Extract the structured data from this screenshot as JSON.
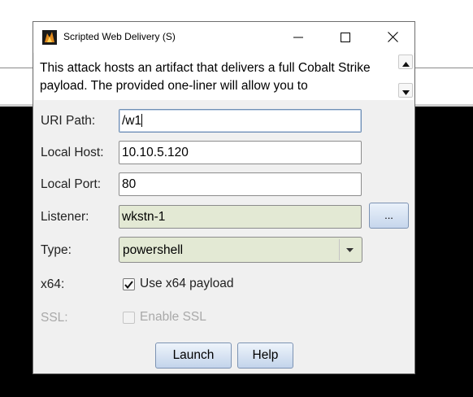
{
  "window": {
    "title": "Scripted Web Delivery (S)"
  },
  "description": "This attack hosts an artifact that delivers a full Cobalt Strike payload. The provided one-liner will allow you to",
  "form": {
    "uri_path": {
      "label": "URI Path:",
      "value": "/w1"
    },
    "local_host": {
      "label": "Local Host:",
      "value": "10.10.5.120"
    },
    "local_port": {
      "label": "Local Port:",
      "value": "80"
    },
    "listener": {
      "label": "Listener:",
      "value": "wkstn-1",
      "browse_label": "..."
    },
    "type": {
      "label": "Type:",
      "value": "powershell"
    },
    "x64": {
      "label": "x64:",
      "checkbox_label": "Use x64 payload",
      "checked": true
    },
    "ssl": {
      "label": "SSL:",
      "checkbox_label": "Enable SSL",
      "checked": false,
      "enabled": false
    }
  },
  "buttons": {
    "launch": "Launch",
    "help": "Help"
  },
  "icons": {
    "app": "cobalt-strike-icon",
    "minimize": "minimize-icon",
    "maximize": "maximize-icon",
    "close": "close-icon",
    "scroll_up": "arrow-up-icon",
    "scroll_down": "arrow-down-icon",
    "dropdown": "chevron-down-icon",
    "check": "checkmark-icon"
  },
  "colors": {
    "readonly_field": "#e3e9d4",
    "button_gradient_top": "#eef4fb",
    "button_gradient_bottom": "#c3d4eb",
    "disabled_text": "#a9a9a9"
  }
}
